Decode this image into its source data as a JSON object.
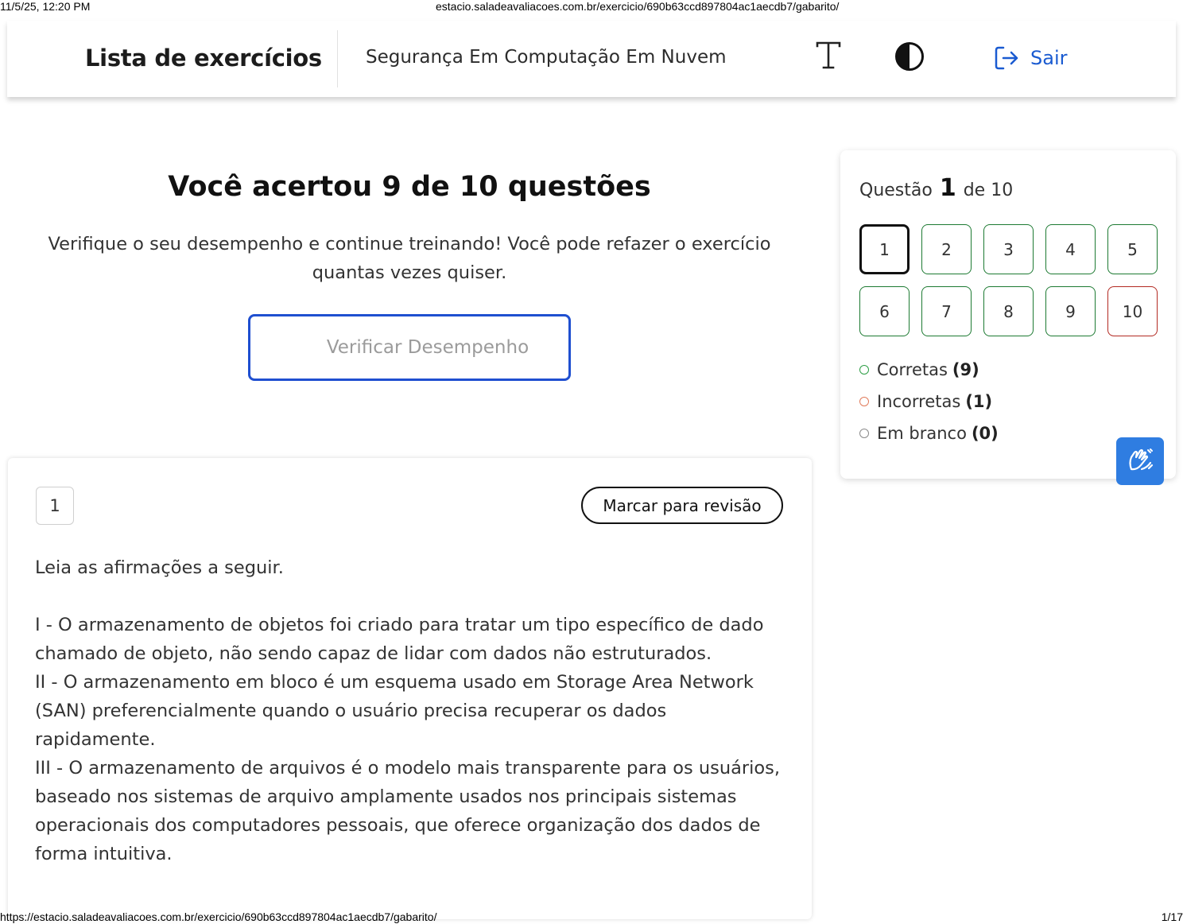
{
  "print_header": {
    "datetime": "11/5/25, 12:20 PM",
    "url": "estacio.saladeavaliacoes.com.br/exercicio/690b63ccd897804ac1aecdb7/gabarito/"
  },
  "print_footer": {
    "url": "https://estacio.saladeavaliacoes.com.br/exercicio/690b63ccd897804ac1aecdb7/gabarito/",
    "page": "1/17"
  },
  "topbar": {
    "title": "Lista de exercícios",
    "subject": "Segurança Em Computação Em Nuvem",
    "font_icon": "font-size-icon",
    "contrast_icon": "contrast-icon",
    "logout_label": "Sair",
    "logout_icon": "logout-icon",
    "accent_color": "#1a5bd1"
  },
  "result": {
    "title": "Você acertou 9 de 10 questões",
    "description": "Verifique o seu desempenho e continue treinando! Você pode refazer o exercício quantas vezes quiser.",
    "button_label": "Verificar Desempenho"
  },
  "question_nav": {
    "prefix": "Questão",
    "current": "1",
    "suffix": "de 10",
    "questions": [
      {
        "number": "1",
        "status": "current"
      },
      {
        "number": "2",
        "status": "correct"
      },
      {
        "number": "3",
        "status": "correct"
      },
      {
        "number": "4",
        "status": "correct"
      },
      {
        "number": "5",
        "status": "correct"
      },
      {
        "number": "6",
        "status": "correct"
      },
      {
        "number": "7",
        "status": "correct"
      },
      {
        "number": "8",
        "status": "correct"
      },
      {
        "number": "9",
        "status": "correct"
      },
      {
        "number": "10",
        "status": "incorrect"
      }
    ],
    "legend": {
      "correct_label": "Corretas",
      "correct_count": "(9)",
      "correct_color": "#2e9e46",
      "incorrect_label": "Incorretas",
      "incorrect_count": "(1)",
      "incorrect_color": "#e07a5a",
      "blank_label": "Em branco",
      "blank_count": "(0)",
      "blank_color": "#8a8a8a"
    }
  },
  "accessibility": {
    "libras_icon": "sign-language-icon"
  },
  "question": {
    "number": "1",
    "review_label": "Marcar para revisão",
    "intro": "Leia as afirmações a seguir.",
    "statements": [
      "I - O armazenamento de objetos foi criado para tratar um tipo específico de dado chamado de objeto, não sendo capaz de lidar com dados não estruturados.",
      "II - O armazenamento em bloco é um esquema usado em Storage Area Network (SAN) preferencialmente quando o usuário precisa recuperar os dados rapidamente.",
      "III - O armazenamento de arquivos é o modelo mais transparente para os usuários, baseado nos sistemas de arquivo amplamente usados nos principais sistemas operacionais dos computadores pessoais, que oferece organização dos dados de forma intuitiva."
    ]
  }
}
